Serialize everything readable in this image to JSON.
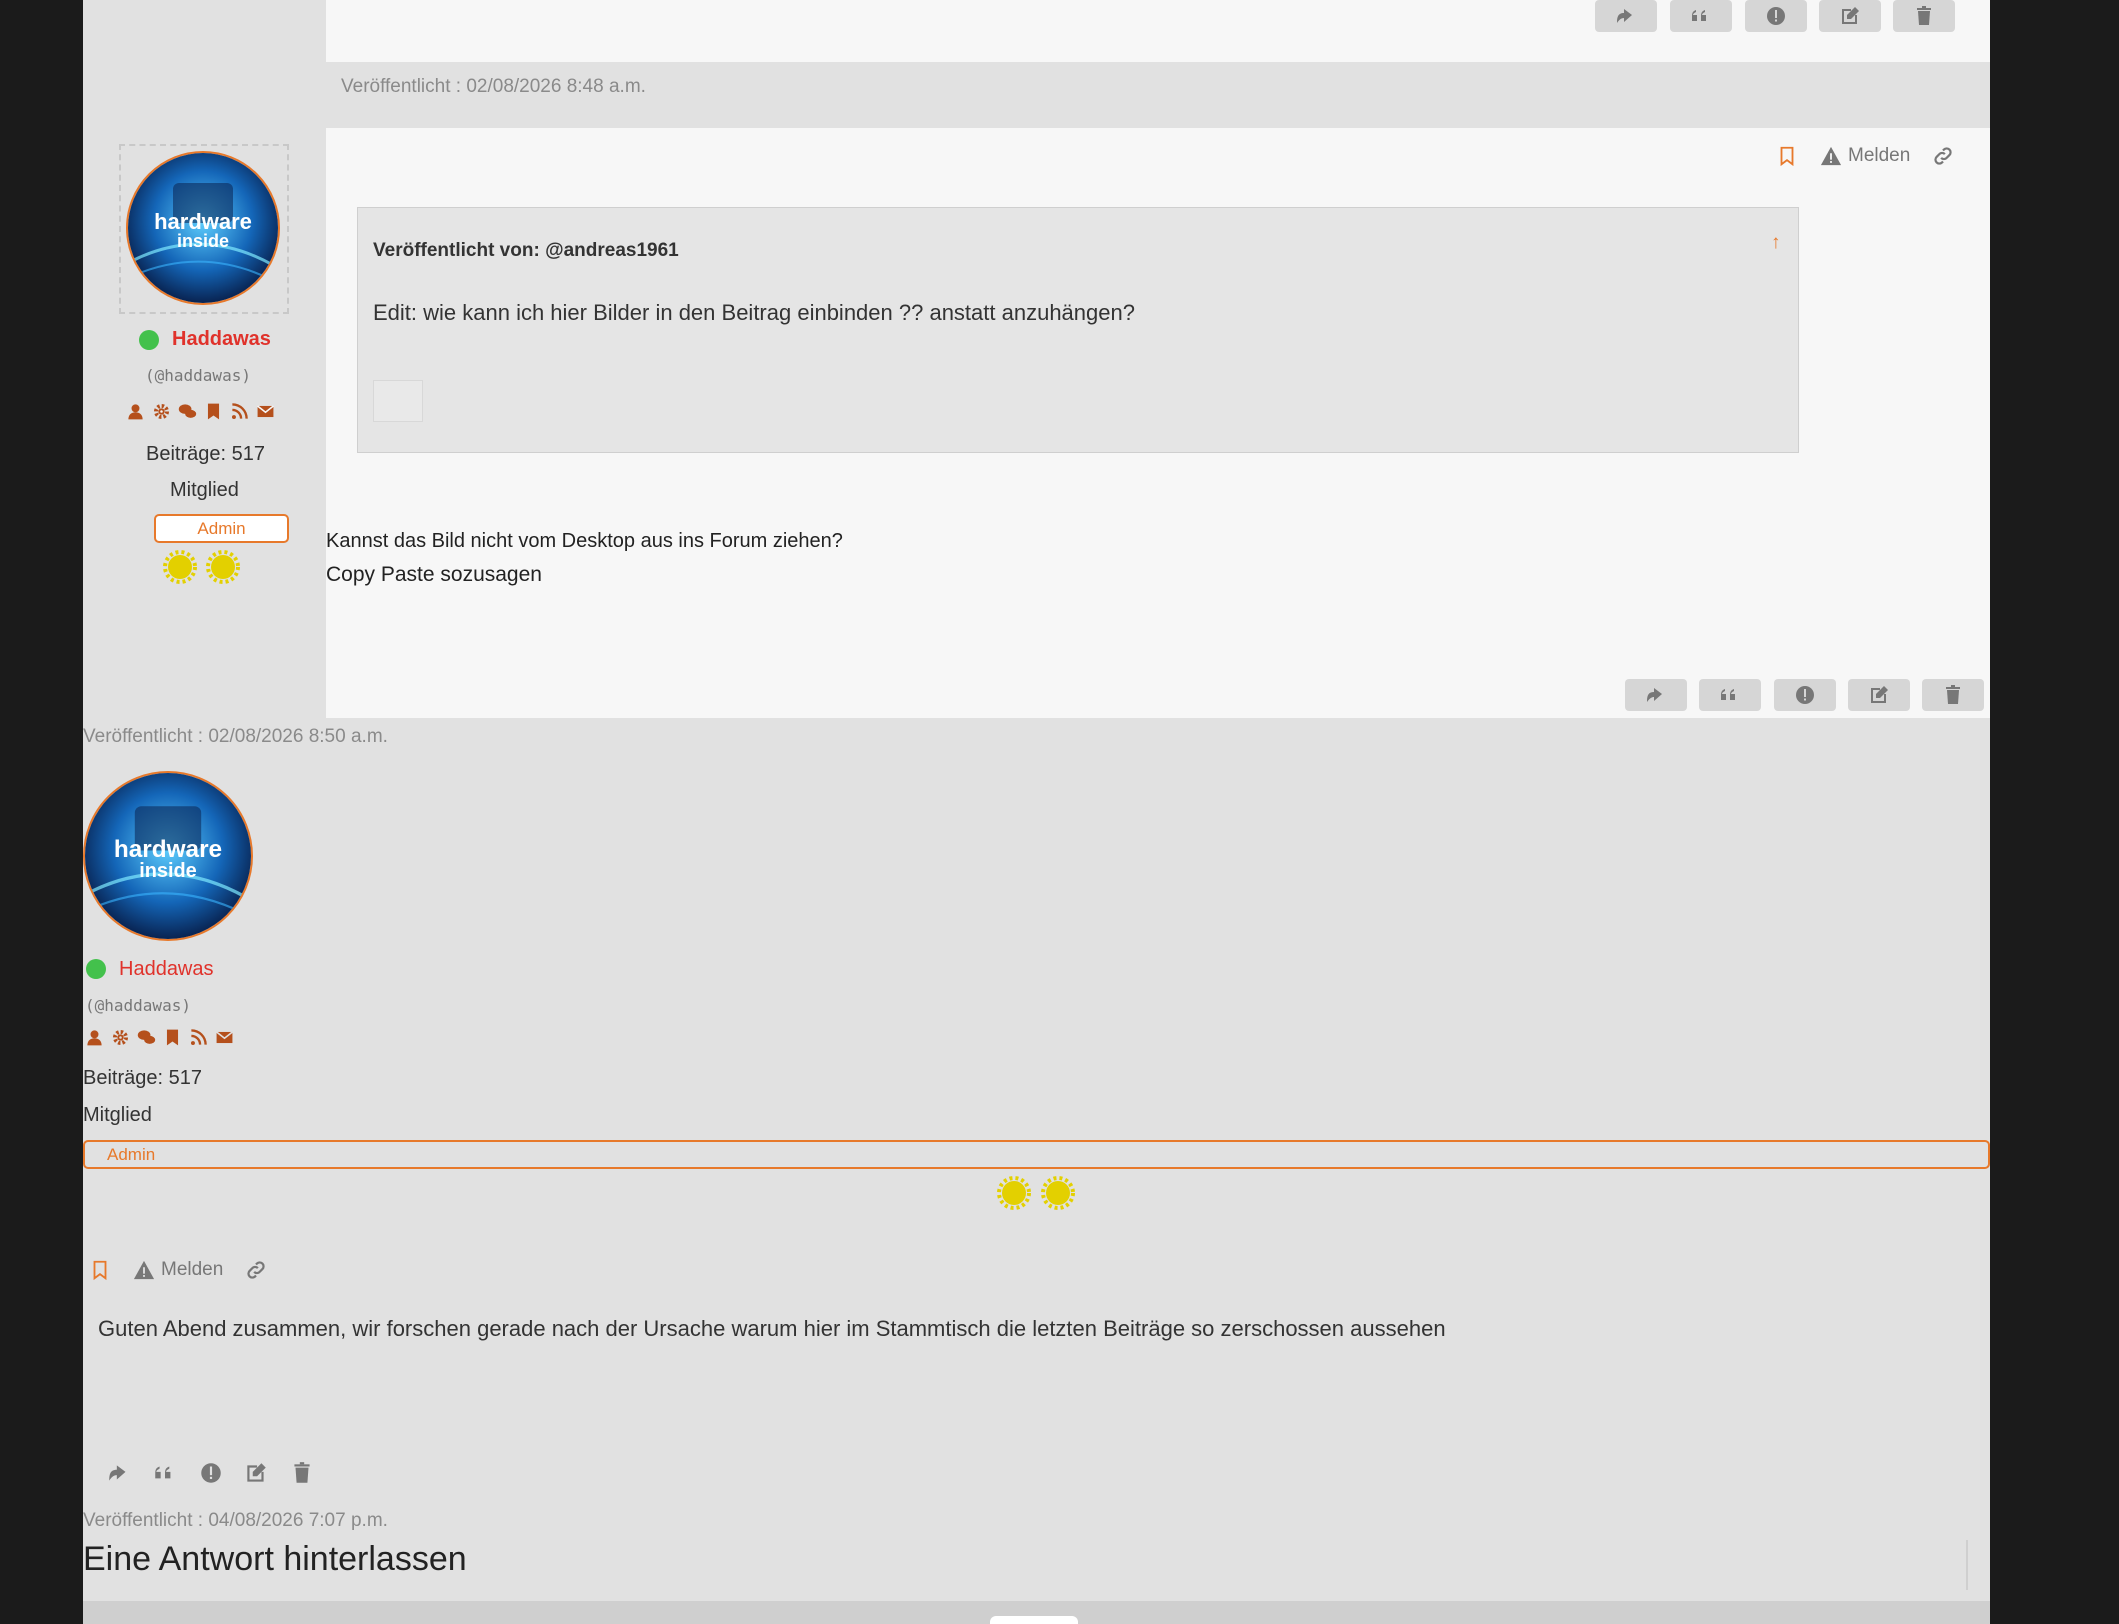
{
  "post1": {
    "published": "Veröffentlicht : 02/08/2026 8:48 a.m."
  },
  "post2": {
    "author": {
      "name": "Haddawas",
      "handle": "(@haddawas)",
      "posts": "Beiträge: 517",
      "role": "Mitglied",
      "badge": "Admin",
      "avatar_text_1": "hardware",
      "avatar_text_2": "inside"
    },
    "tools": {
      "report": "Melden"
    },
    "quote": {
      "author": "Veröffentlicht von: @andreas1961",
      "text": "Edit: wie kann ich hier Bilder in den Beitrag einbinden ?? anstatt anzuhängen?",
      "jump": "↑"
    },
    "body_line1": "Kannst das Bild nicht vom Desktop aus ins Forum ziehen?",
    "body_line2": "Copy Paste sozusagen",
    "published": "Veröffentlicht : 02/08/2026 8:50 a.m."
  },
  "post3": {
    "author": {
      "name": "Haddawas",
      "handle": "(@haddawas)",
      "posts": "Beiträge: 517",
      "role": "Mitglied",
      "badge": "Admin"
    },
    "tools": {
      "report": "Melden"
    },
    "body": "Guten Abend zusammen, wir forschen gerade nach der Ursache warum hier im Stammtisch die letzten Beiträge so zerschossen aussehen",
    "published": "Veröffentlicht : 04/08/2026 7:07 p.m."
  },
  "reply": {
    "title": "Eine Antwort hinterlassen"
  },
  "colors": {
    "accent": "#e7792b",
    "username": "#e0322b",
    "online": "#43c14c",
    "icon_brown": "#b5501c",
    "badge_sun": "#e3d000"
  },
  "icons": [
    "reply-icon",
    "quote-icon",
    "report-icon",
    "edit-icon",
    "delete-icon",
    "bookmark-icon",
    "warning-icon",
    "link-icon",
    "profile-icon",
    "gear-icon",
    "chat-icon",
    "rss-icon",
    "mail-icon"
  ]
}
